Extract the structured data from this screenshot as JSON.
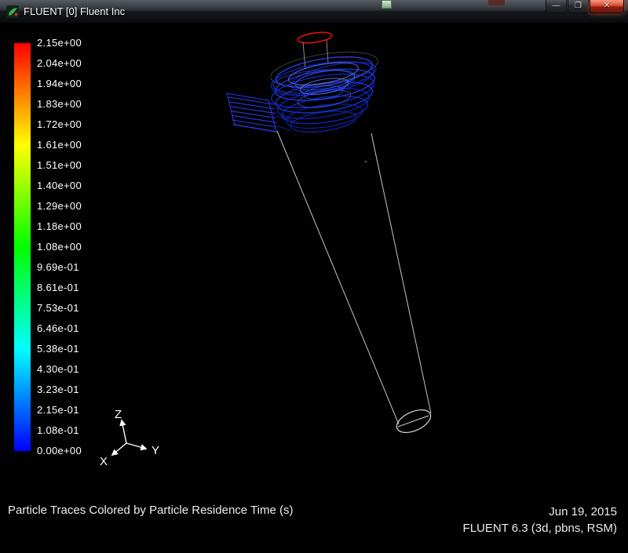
{
  "window": {
    "title": "FLUENT [0] Fluent Inc",
    "controls": {
      "minimize": "—",
      "maximize": "❐",
      "close": "✕"
    }
  },
  "legend": {
    "labels": [
      "2.15e+00",
      "2.04e+00",
      "1.94e+00",
      "1.83e+00",
      "1.72e+00",
      "1.61e+00",
      "1.51e+00",
      "1.40e+00",
      "1.29e+00",
      "1.18e+00",
      "1.08e+00",
      "9.69e-01",
      "8.61e-01",
      "7.53e-01",
      "6.46e-01",
      "5.38e-01",
      "4.30e-01",
      "3.23e-01",
      "2.15e-01",
      "1.08e-01",
      "0.00e+00"
    ],
    "colors": [
      "#ff0000",
      "#ff3300",
      "#ff6600",
      "#ff9900",
      "#ffcc00",
      "#ffff00",
      "#ccff00",
      "#99ff00",
      "#66ff00",
      "#33ff00",
      "#00ff00",
      "#00ff33",
      "#00ff66",
      "#00ff99",
      "#00ffcc",
      "#00ffff",
      "#00ccff",
      "#0099ff",
      "#0066ff",
      "#0033ff",
      "#0000ff"
    ]
  },
  "axes": {
    "x": "X",
    "y": "Y",
    "z": "Z"
  },
  "caption": {
    "title": "Particle Traces Colored by Particle Residence Time (s)",
    "date": "Jun 19, 2015",
    "version": "FLUENT 6.3 (3d, pbns, RSM)"
  }
}
